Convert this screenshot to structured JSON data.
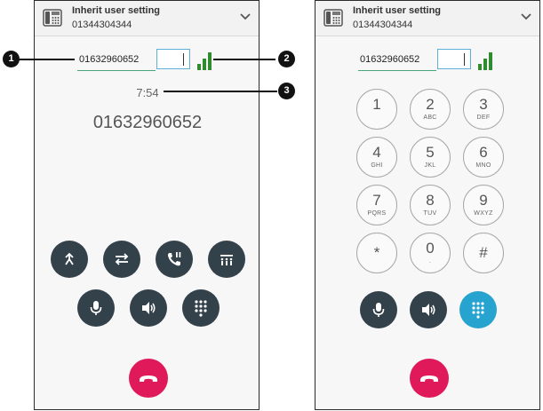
{
  "left_panel": {
    "header": {
      "title": "Inherit user setting",
      "subtitle": "01344304344",
      "icon": "desk-phone-icon",
      "chevron_icon": "chevron-down-icon"
    },
    "number_field": "01632960652",
    "timer": "7:54",
    "display_number": "01632960652",
    "controls_row1": [
      {
        "name": "park-call-button",
        "icon": "park-icon"
      },
      {
        "name": "transfer-button",
        "icon": "transfer-arrows-icon"
      },
      {
        "name": "hold-button",
        "icon": "phone-pause-icon"
      },
      {
        "name": "conference-button",
        "icon": "conference-icon"
      }
    ],
    "controls_row2": [
      {
        "name": "mute-button",
        "icon": "microphone-icon"
      },
      {
        "name": "speaker-button",
        "icon": "speaker-icon"
      },
      {
        "name": "keypad-button",
        "icon": "keypad-icon"
      }
    ],
    "hangup_icon": "hang-up-icon"
  },
  "right_panel": {
    "header": {
      "title": "Inherit user setting",
      "subtitle": "01344304344",
      "icon": "desk-phone-icon",
      "chevron_icon": "chevron-down-icon"
    },
    "number_field": "01632960652",
    "keys": [
      {
        "digit": "1",
        "letters": ""
      },
      {
        "digit": "2",
        "letters": "ABC"
      },
      {
        "digit": "3",
        "letters": "DEF"
      },
      {
        "digit": "4",
        "letters": "GHI"
      },
      {
        "digit": "5",
        "letters": "JKL"
      },
      {
        "digit": "6",
        "letters": "MNO"
      },
      {
        "digit": "7",
        "letters": "PQRS"
      },
      {
        "digit": "8",
        "letters": "TUV"
      },
      {
        "digit": "9",
        "letters": "WXYZ"
      },
      {
        "digit": "*",
        "letters": ""
      },
      {
        "digit": "0",
        "letters": "."
      },
      {
        "digit": "#",
        "letters": ""
      }
    ],
    "controls": [
      {
        "name": "mute-button",
        "icon": "microphone-icon"
      },
      {
        "name": "speaker-button",
        "icon": "speaker-icon"
      },
      {
        "name": "keypad-button",
        "icon": "keypad-icon",
        "active": true
      }
    ],
    "hangup_icon": "hang-up-icon"
  },
  "callouts": [
    "1",
    "2",
    "3"
  ],
  "colors": {
    "accent": "#27a3cf",
    "button_dark": "#33414b",
    "hangup": "#e0195b",
    "signal": "#2e8b2e"
  }
}
